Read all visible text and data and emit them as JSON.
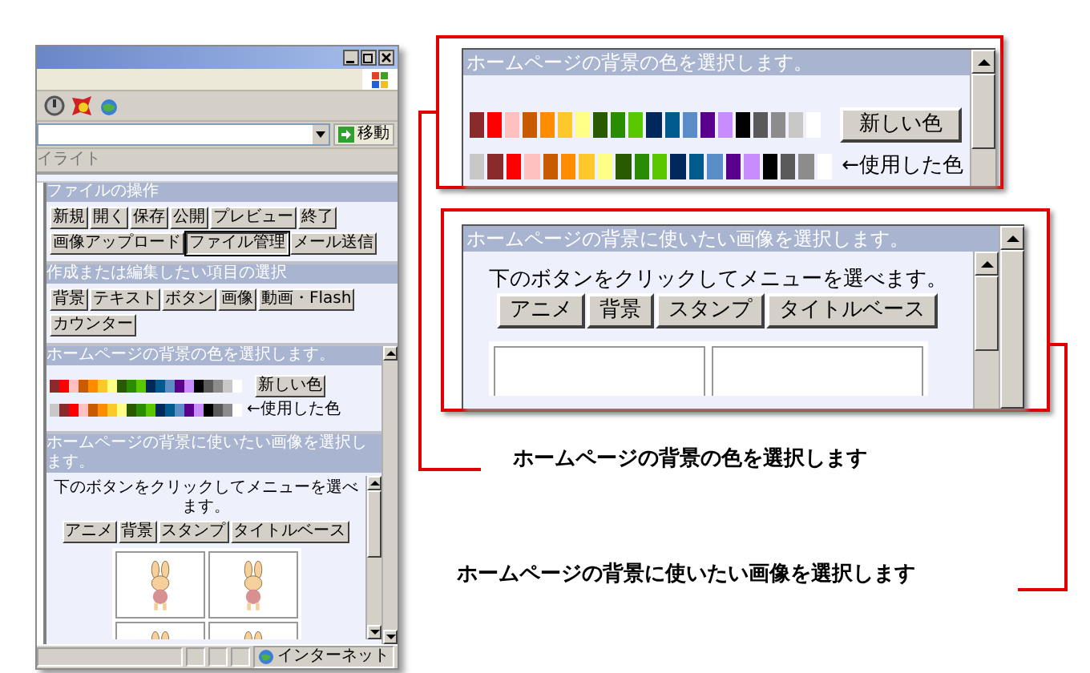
{
  "mini": {
    "address_go": "移動",
    "links_label": "イライト",
    "sections": [
      {
        "kind": "buttons",
        "title": "ファイルの操作",
        "rows": [
          {
            "buttons": [
              {
                "label": "新規",
                "selected": false
              },
              {
                "label": "開く",
                "selected": false
              },
              {
                "label": "保存",
                "selected": false
              },
              {
                "label": "公開",
                "selected": false
              },
              {
                "label": "プレビュー",
                "selected": false
              },
              {
                "label": "終了",
                "selected": false
              }
            ]
          },
          {
            "buttons": [
              {
                "label": "画像アップロード",
                "selected": false
              },
              {
                "label": "ファイル管理",
                "selected": true
              },
              {
                "label": "メール送信",
                "selected": false
              }
            ]
          }
        ]
      },
      {
        "kind": "buttons",
        "title": "作成または編集したい項目の選択",
        "rows": [
          {
            "buttons": [
              {
                "label": "背景",
                "selected": false
              },
              {
                "label": "テキスト",
                "selected": false
              },
              {
                "label": "ボタン",
                "selected": false
              },
              {
                "label": "画像",
                "selected": false
              },
              {
                "label": "動画・Flash",
                "selected": false
              }
            ]
          },
          {
            "buttons": [
              {
                "label": "カウンター",
                "selected": false
              }
            ]
          }
        ]
      },
      {
        "kind": "colors",
        "title": "ホームページの背景の色を選択します。",
        "new_button": "新しい色",
        "used_label": "←使用した色",
        "palette": [
          {
            "color": "#8b2a2a"
          },
          {
            "color": "#ff0000"
          },
          {
            "color": "#ffc0c0"
          },
          {
            "color": "#c85a00"
          },
          {
            "color": "#ff8c00"
          },
          {
            "color": "#ffc82a"
          },
          {
            "color": "#ffff88"
          },
          {
            "color": "#2a5a00"
          },
          {
            "color": "#2a8c00"
          },
          {
            "color": "#5ac800"
          },
          {
            "color": "#00285a"
          },
          {
            "color": "#005a8c"
          },
          {
            "color": "#5a8cc8"
          },
          {
            "color": "#5a008c"
          },
          {
            "color": "#c88cff"
          },
          {
            "color": "#000000"
          },
          {
            "color": "#5a5a5a"
          },
          {
            "color": "#8c8c8c"
          },
          {
            "color": "#c8c8c8"
          },
          {
            "color": "#ffffff"
          }
        ],
        "used": [
          {
            "color": "#c8c8c8"
          },
          {
            "color": "#8b2a2a"
          },
          {
            "color": "#ff0000"
          },
          {
            "color": "#ffc0c0"
          },
          {
            "color": "#c85a00"
          },
          {
            "color": "#ff8c00"
          },
          {
            "color": "#ffc82a"
          },
          {
            "color": "#ffff88"
          },
          {
            "color": "#2a5a00"
          },
          {
            "color": "#2a8c00"
          },
          {
            "color": "#5ac800"
          },
          {
            "color": "#00285a"
          },
          {
            "color": "#005a8c"
          },
          {
            "color": "#5a8cc8"
          },
          {
            "color": "#5a008c"
          },
          {
            "color": "#c88cff"
          },
          {
            "color": "#000000"
          },
          {
            "color": "#5a5a5a"
          },
          {
            "color": "#8c8c8c"
          },
          {
            "color": "#ffffff"
          }
        ]
      },
      {
        "kind": "images",
        "title": "ホームページの背景に使いたい画像を選択します。",
        "instruction": "下のボタンをクリックしてメニューを選べます。",
        "tabs": [
          {
            "label": "アニメ",
            "selected": false
          },
          {
            "label": "背景",
            "selected": false
          },
          {
            "label": "スタンプ",
            "selected": false
          },
          {
            "label": "タイトルベース",
            "selected": false
          }
        ],
        "images": [
          {
            "kind": "picture"
          },
          {
            "kind": "picture"
          },
          {
            "kind": "picture"
          },
          {
            "kind": "picture"
          }
        ]
      }
    ],
    "status": "インターネット"
  },
  "zoom": [
    {
      "kind": "colors",
      "title": "ホームページの背景の色を選択します。",
      "new_button": "新しい色",
      "used_label": "←使用した色",
      "palette": [
        {
          "color": "#8b2a2a"
        },
        {
          "color": "#ff0000"
        },
        {
          "color": "#ffc0c0"
        },
        {
          "color": "#c85a00"
        },
        {
          "color": "#ff8c00"
        },
        {
          "color": "#ffc82a"
        },
        {
          "color": "#ffff88"
        },
        {
          "color": "#2a5a00"
        },
        {
          "color": "#2a8c00"
        },
        {
          "color": "#5ac800"
        },
        {
          "color": "#00285a"
        },
        {
          "color": "#005a8c"
        },
        {
          "color": "#5a8cc8"
        },
        {
          "color": "#5a008c"
        },
        {
          "color": "#c88cff"
        },
        {
          "color": "#000000"
        },
        {
          "color": "#5a5a5a"
        },
        {
          "color": "#8c8c8c"
        },
        {
          "color": "#c8c8c8"
        },
        {
          "color": "#ffffff"
        }
      ],
      "used": [
        {
          "color": "#c8c8c8"
        },
        {
          "color": "#8b2a2a"
        },
        {
          "color": "#ff0000"
        },
        {
          "color": "#ffc0c0"
        },
        {
          "color": "#c85a00"
        },
        {
          "color": "#ff8c00"
        },
        {
          "color": "#ffc82a"
        },
        {
          "color": "#ffff88"
        },
        {
          "color": "#2a5a00"
        },
        {
          "color": "#2a8c00"
        },
        {
          "color": "#5ac800"
        },
        {
          "color": "#00285a"
        },
        {
          "color": "#005a8c"
        },
        {
          "color": "#5a8cc8"
        },
        {
          "color": "#5a008c"
        },
        {
          "color": "#c88cff"
        },
        {
          "color": "#000000"
        },
        {
          "color": "#5a5a5a"
        },
        {
          "color": "#8c8c8c"
        },
        {
          "color": "#ffffff"
        }
      ]
    },
    {
      "kind": "images",
      "title": "ホームページの背景に使いたい画像を選択します。",
      "instruction": "下のボタンをクリックしてメニューを選べます。",
      "tabs": [
        {
          "label": "アニメ",
          "selected": false
        },
        {
          "label": "背景",
          "selected": false
        },
        {
          "label": "スタンプ",
          "selected": false
        },
        {
          "label": "タイトルベース",
          "selected": false
        }
      ]
    }
  ],
  "callouts": [
    {
      "text": "ホームページの背景の色を選択します"
    },
    {
      "text": "ホームページの背景に使いたい画像を選択します"
    }
  ]
}
